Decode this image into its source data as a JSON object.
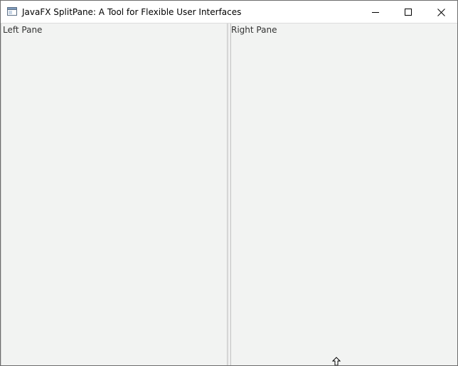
{
  "window": {
    "title": "JavaFX SplitPane: A Tool for Flexible User Interfaces",
    "app_icon": "java-window-icon",
    "controls": {
      "minimize_icon": "minimize-icon",
      "maximize_icon": "maximize-icon",
      "close_icon": "close-icon"
    }
  },
  "split_pane": {
    "left_pane": {
      "label": "Left Pane"
    },
    "right_pane": {
      "label": "Right Pane"
    },
    "divider_icon": "split-divider"
  },
  "cursor": {
    "icon": "up-arrow-cursor-icon"
  },
  "colors": {
    "pane_background": "#f2f3f2",
    "titlebar_background": "#ffffff",
    "divider": "#e6e6e6",
    "text": "#333333"
  }
}
